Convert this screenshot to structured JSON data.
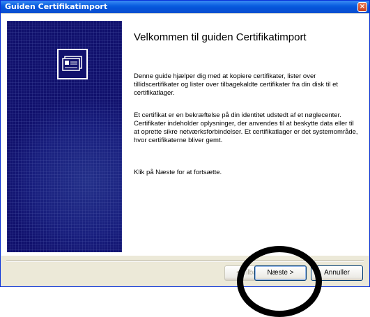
{
  "window": {
    "title": "Guiden Certifikatimport",
    "close_label": "×"
  },
  "wizard": {
    "heading": "Velkommen til guiden Certifikatimport",
    "paragraph1": "Denne guide hjælper dig med at kopiere certifikater, lister over tillidscertifikater og lister over tilbagekaldte certifikater fra din disk til et certifikatlager.",
    "paragraph2": "Et certifikat er en bekræftelse på din identitet udstedt af et nøglecenter. Certifikater indeholder oplysninger, der anvendes til at beskytte data eller til at oprette sikre netværksforbindelser. Et certifikatlager er det systemområde, hvor certifikaterne bliver gemt.",
    "paragraph3": "Klik på Næste for at fortsætte."
  },
  "buttons": {
    "back_label": "< Tilbage",
    "next_label": "Næste >",
    "cancel_label": "Annuller"
  }
}
